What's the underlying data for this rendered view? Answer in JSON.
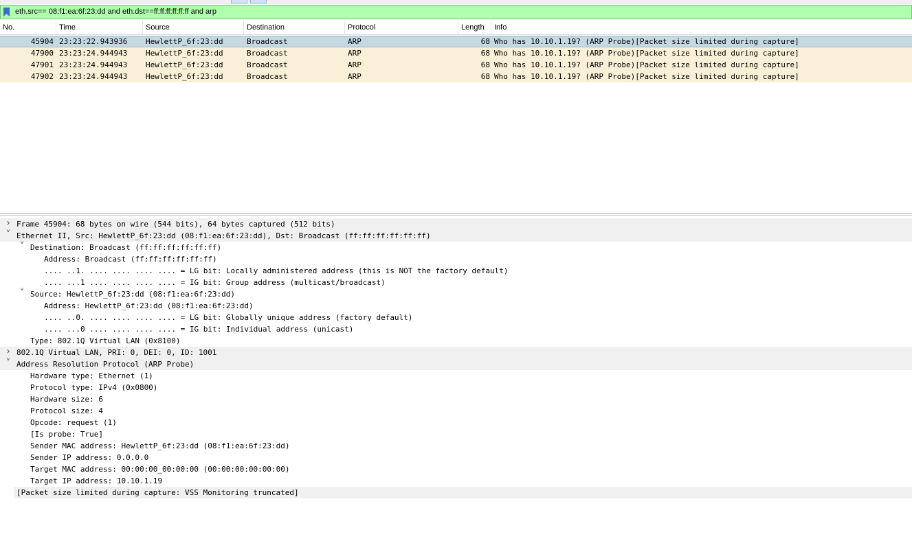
{
  "filter": {
    "text": "eth.src== 08:f1:ea:6f:23:dd and eth.dst==ff:ff:ff:ff:ff:ff and arp"
  },
  "packet_list": {
    "columns": [
      "No.",
      "Time",
      "Source",
      "Destination",
      "Protocol",
      "Length",
      "Info"
    ],
    "rows": [
      {
        "no": "45904",
        "time": "23:23:22.943936",
        "source": "HewlettP_6f:23:dd",
        "destination": "Broadcast",
        "protocol": "ARP",
        "length": "68",
        "info": "Who has 10.10.1.19? (ARP Probe)[Packet size limited during capture]",
        "selected": true
      },
      {
        "no": "47900",
        "time": "23:23:24.944943",
        "source": "HewlettP_6f:23:dd",
        "destination": "Broadcast",
        "protocol": "ARP",
        "length": "68",
        "info": "Who has 10.10.1.19? (ARP Probe)[Packet size limited during capture]",
        "selected": false
      },
      {
        "no": "47901",
        "time": "23:23:24.944943",
        "source": "HewlettP_6f:23:dd",
        "destination": "Broadcast",
        "protocol": "ARP",
        "length": "68",
        "info": "Who has 10.10.1.19? (ARP Probe)[Packet size limited during capture]",
        "selected": false
      },
      {
        "no": "47902",
        "time": "23:23:24.944943",
        "source": "HewlettP_6f:23:dd",
        "destination": "Broadcast",
        "protocol": "ARP",
        "length": "68",
        "info": "Who has 10.10.1.19? (ARP Probe)[Packet size limited during capture]",
        "selected": false
      }
    ]
  },
  "details": {
    "lines": [
      {
        "text": "Frame 45904: 68 bytes on wire (544 bits), 64 bytes captured (512 bits)",
        "state": "collapsed",
        "indent": 0,
        "shaded": true
      },
      {
        "text": "Ethernet II, Src: HewlettP_6f:23:dd (08:f1:ea:6f:23:dd), Dst: Broadcast (ff:ff:ff:ff:ff:ff)",
        "state": "expanded",
        "indent": 0,
        "shaded": true
      },
      {
        "text": "Destination: Broadcast (ff:ff:ff:ff:ff:ff)",
        "state": "expanded",
        "indent": 1,
        "shaded": false
      },
      {
        "text": "Address: Broadcast (ff:ff:ff:ff:ff:ff)",
        "state": "leaf",
        "indent": 2,
        "shaded": false
      },
      {
        "text": ".... ..1. .... .... .... .... = LG bit: Locally administered address (this is NOT the factory default)",
        "state": "leaf",
        "indent": 2,
        "shaded": false
      },
      {
        "text": ".... ...1 .... .... .... .... = IG bit: Group address (multicast/broadcast)",
        "state": "leaf",
        "indent": 2,
        "shaded": false
      },
      {
        "text": "Source: HewlettP_6f:23:dd (08:f1:ea:6f:23:dd)",
        "state": "expanded",
        "indent": 1,
        "shaded": false
      },
      {
        "text": "Address: HewlettP_6f:23:dd (08:f1:ea:6f:23:dd)",
        "state": "leaf",
        "indent": 2,
        "shaded": false
      },
      {
        "text": ".... ..0. .... .... .... .... = LG bit: Globally unique address (factory default)",
        "state": "leaf",
        "indent": 2,
        "shaded": false
      },
      {
        "text": ".... ...0 .... .... .... .... = IG bit: Individual address (unicast)",
        "state": "leaf",
        "indent": 2,
        "shaded": false
      },
      {
        "text": "Type: 802.1Q Virtual LAN (0x8100)",
        "state": "leaf",
        "indent": 1,
        "shaded": false
      },
      {
        "text": "802.1Q Virtual LAN, PRI: 0, DEI: 0, ID: 1001",
        "state": "collapsed",
        "indent": 0,
        "shaded": true
      },
      {
        "text": "Address Resolution Protocol (ARP Probe)",
        "state": "expanded",
        "indent": 0,
        "shaded": true
      },
      {
        "text": "Hardware type: Ethernet (1)",
        "state": "leaf",
        "indent": 1,
        "shaded": false
      },
      {
        "text": "Protocol type: IPv4 (0x0800)",
        "state": "leaf",
        "indent": 1,
        "shaded": false
      },
      {
        "text": "Hardware size: 6",
        "state": "leaf",
        "indent": 1,
        "shaded": false
      },
      {
        "text": "Protocol size: 4",
        "state": "leaf",
        "indent": 1,
        "shaded": false
      },
      {
        "text": "Opcode: request (1)",
        "state": "leaf",
        "indent": 1,
        "shaded": false
      },
      {
        "text": "[Is probe: True]",
        "state": "leaf",
        "indent": 1,
        "shaded": false
      },
      {
        "text": "Sender MAC address: HewlettP_6f:23:dd (08:f1:ea:6f:23:dd)",
        "state": "leaf",
        "indent": 1,
        "shaded": false
      },
      {
        "text": "Sender IP address: 0.0.0.0",
        "state": "leaf",
        "indent": 1,
        "shaded": false
      },
      {
        "text": "Target MAC address: 00:00:00_00:00:00 (00:00:00:00:00:00)",
        "state": "leaf",
        "indent": 1,
        "shaded": false
      },
      {
        "text": "Target IP address: 10.10.1.19",
        "state": "leaf",
        "indent": 1,
        "shaded": false
      },
      {
        "text": "[Packet size limited during capture: VSS Monitoring truncated]",
        "state": "leaf",
        "indent": 0,
        "shaded": true,
        "trunc": true
      }
    ]
  },
  "colors": {
    "filter_valid": "#afffaf",
    "row_arp": "#faf0d7",
    "row_selected": "#c6d9e3"
  }
}
